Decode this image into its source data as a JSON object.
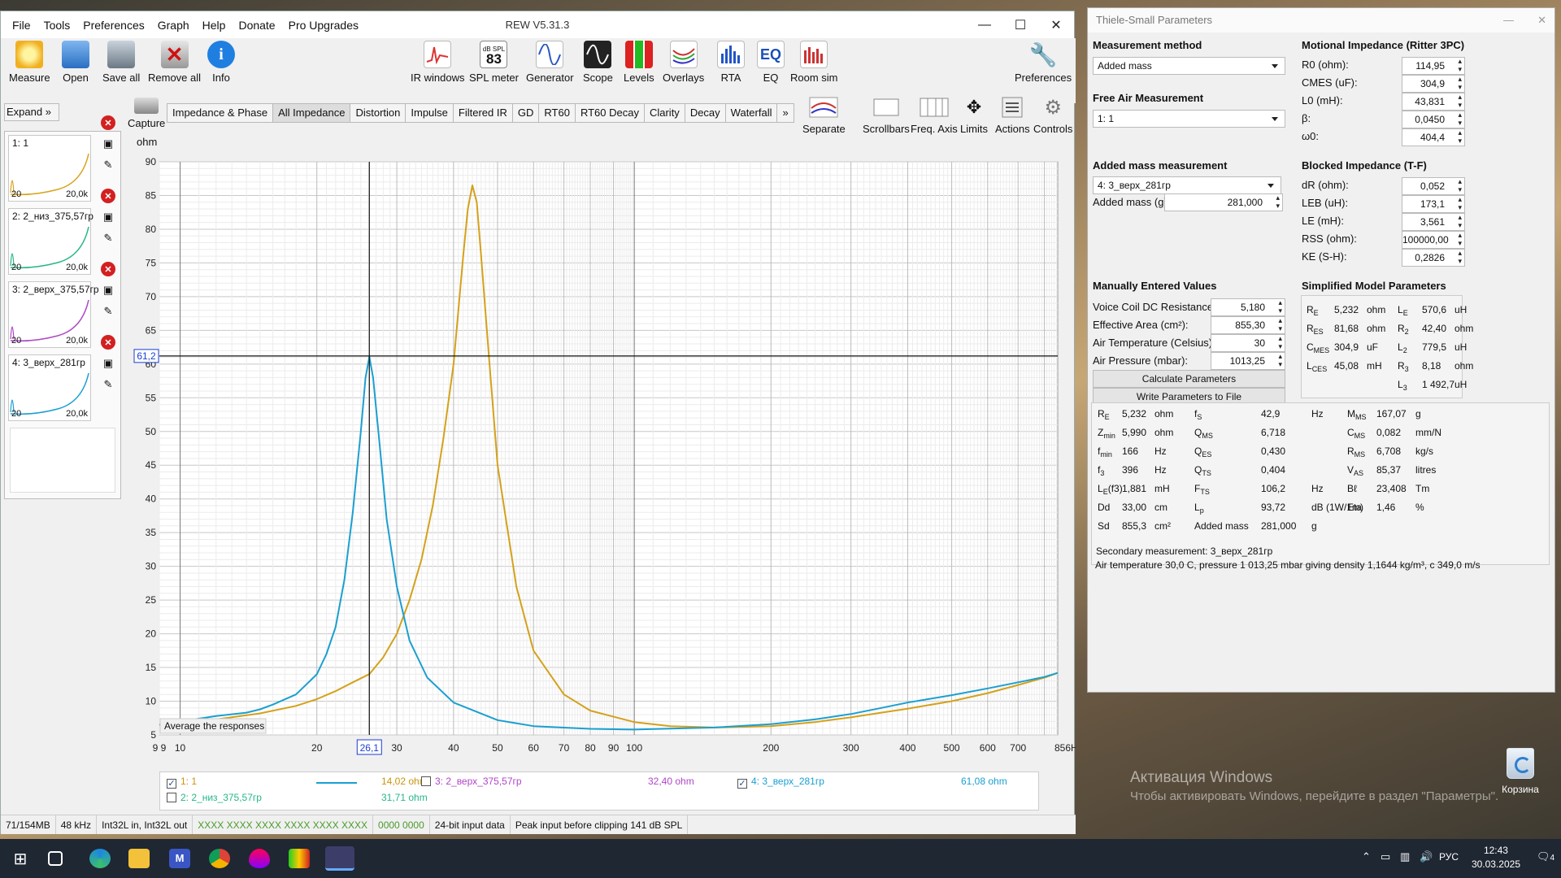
{
  "rew": {
    "title": "REW V5.31.3",
    "menu": [
      "File",
      "Tools",
      "Preferences",
      "Graph",
      "Help",
      "Donate",
      "Pro Upgrades"
    ],
    "toolbar_left": [
      "Measure",
      "Open",
      "Save all",
      "Remove all",
      "Info"
    ],
    "toolbar_right": [
      "IR windows",
      "SPL meter",
      "Generator",
      "Scope",
      "Levels",
      "Overlays",
      "RTA",
      "EQ",
      "Room sim"
    ],
    "spl_meter_badge_top": "dB SPL",
    "spl_meter_badge_value": "83",
    "eq_badge": "EQ",
    "preferences_label": "Preferences",
    "expand_label": "Expand",
    "expand_chevron": "»",
    "capture_label": "Capture",
    "graph_tabs": [
      "Impedance & Phase",
      "All Impedance",
      "Distortion",
      "Impulse",
      "Filtered IR",
      "GD",
      "RT60",
      "RT60 Decay",
      "Clarity",
      "Decay",
      "Waterfall"
    ],
    "active_tab": "All Impedance",
    "tabs_more": "»",
    "graph_buttons": [
      "Separate",
      "Scrollbars",
      "Freq. Axis",
      "Limits",
      "Actions",
      "Controls"
    ],
    "measurements": [
      {
        "name": "1: 1",
        "lo": "20",
        "hi": "20,0k",
        "color": "#d9a31a"
      },
      {
        "name": "2: 2_низ_375,57гр",
        "lo": "20",
        "hi": "20,0k",
        "color": "#27b58a"
      },
      {
        "name": "3: 2_верх_375,57гр",
        "lo": "20",
        "hi": "20,0k",
        "color": "#b045c8"
      },
      {
        "name": "4: 3_верх_281гр",
        "lo": "20",
        "hi": "20,0k",
        "color": "#1a9fd2"
      }
    ],
    "status": [
      "71/154MB",
      "48 kHz",
      "Int32L in, Int32L out",
      "XXXX XXXX  XXXX XXXX  XXXX XXXX",
      "0000 0000",
      "24-bit input data",
      "Peak input before clipping 141 dB SPL"
    ],
    "legend": [
      {
        "checked": true,
        "name": "1: 1",
        "value": "14,02 ohm",
        "color": "#c9950c"
      },
      {
        "checked": false,
        "name": "2: 2_низ_375,57гр",
        "value": "31,71 ohm",
        "color": "#27b58a"
      },
      {
        "checked": false,
        "name": "3: 2_верх_375,57гр",
        "value": "32,40 ohm",
        "color": "#b045c8"
      },
      {
        "checked": true,
        "name": "4: 3_верх_281гр",
        "value": "61,08 ohm",
        "color": "#1a9fd2"
      }
    ],
    "average_button": "Average the responses"
  },
  "chart_data": {
    "type": "line",
    "title": "",
    "xlabel": "",
    "ylabel": "ohm",
    "x_scale": "log",
    "xlim": [
      9,
      856
    ],
    "ylim": [
      5,
      90
    ],
    "yticks": [
      5,
      10,
      15,
      20,
      25,
      30,
      35,
      40,
      45,
      50,
      55,
      60,
      65,
      70,
      75,
      80,
      85,
      90
    ],
    "xtick_labels": [
      {
        "f": 9,
        "label": "9 9"
      },
      {
        "f": 10,
        "label": "10"
      },
      {
        "f": 20,
        "label": "20"
      },
      {
        "f": 30,
        "label": "30"
      },
      {
        "f": 40,
        "label": "40"
      },
      {
        "f": 50,
        "label": "50"
      },
      {
        "f": 60,
        "label": "60"
      },
      {
        "f": 70,
        "label": "70"
      },
      {
        "f": 80,
        "label": "80"
      },
      {
        "f": 90,
        "label": "90"
      },
      {
        "f": 100,
        "label": "100"
      },
      {
        "f": 200,
        "label": "200"
      },
      {
        "f": 300,
        "label": "300"
      },
      {
        "f": 400,
        "label": "400"
      },
      {
        "f": 500,
        "label": "500"
      },
      {
        "f": 600,
        "label": "600"
      },
      {
        "f": 700,
        "label": "700"
      },
      {
        "f": 856,
        "label": "856Hz"
      }
    ],
    "cursor": {
      "x": 26.1,
      "y": 61.2,
      "x_label": "26,1",
      "y_label": "61,2"
    },
    "grid": true,
    "series": [
      {
        "name": "1: 1",
        "color": "#d4a11a",
        "x": [
          9,
          10,
          12,
          15,
          18,
          20,
          22,
          24,
          26.1,
          28,
          30,
          32,
          34,
          36,
          38,
          40,
          41,
          42,
          43,
          44,
          45,
          46,
          48,
          50,
          55,
          60,
          70,
          80,
          100,
          120,
          150,
          200,
          250,
          300,
          350,
          400,
          500,
          600,
          700,
          800,
          856
        ],
        "y": [
          6.5,
          6.8,
          7.3,
          8.2,
          9.3,
          10.3,
          11.5,
          12.8,
          14.02,
          16.5,
          20,
          25,
          31,
          39,
          49,
          60,
          68,
          76,
          83,
          86.5,
          84,
          76,
          60,
          45,
          27,
          17.5,
          11,
          8.6,
          6.9,
          6.3,
          6.1,
          6.3,
          6.9,
          7.6,
          8.3,
          8.9,
          10,
          11.2,
          12.4,
          13.5,
          14.2
        ]
      },
      {
        "name": "4: 3_верх_281гр",
        "color": "#1b9fd0",
        "x": [
          9,
          10,
          12,
          14,
          15,
          16,
          18,
          20,
          21,
          22,
          23,
          24,
          25,
          25.6,
          26.1,
          26.6,
          27.5,
          28.5,
          30,
          32,
          35,
          40,
          50,
          60,
          80,
          100,
          150,
          200,
          250,
          300,
          350,
          400,
          500,
          600,
          700,
          800,
          856
        ],
        "y": [
          6.5,
          7,
          7.8,
          8.3,
          8.8,
          9.5,
          11,
          14,
          17,
          21,
          28,
          38,
          50,
          58,
          61.08,
          58,
          48,
          37,
          27,
          19,
          13.5,
          9.8,
          7.2,
          6.3,
          5.9,
          5.8,
          6.1,
          6.6,
          7.3,
          8.1,
          9,
          9.8,
          10.9,
          11.9,
          12.8,
          13.6,
          14.2
        ]
      }
    ]
  },
  "ts": {
    "title": "Thiele-Small Parameters",
    "measurement_method_h": "Measurement method",
    "measurement_method": "Added mass",
    "free_air_h": "Free Air Measurement",
    "free_air": "1: 1",
    "added_mass_h": "Added mass measurement",
    "added_mass_meas": "4: 3_верх_281гр",
    "added_mass_label": "Added mass (g):",
    "added_mass_value": "281,000",
    "manual_h": "Manually Entered Values",
    "manual": [
      {
        "label": "Voice Coil DC Resistance (ohm):",
        "value": "5,180"
      },
      {
        "label": "Effective Area (cm²):",
        "value": "855,30"
      },
      {
        "label": "Air Temperature (Celsius):",
        "value": "30"
      },
      {
        "label": "Air Pressure (mbar):",
        "value": "1013,25"
      }
    ],
    "calc_button": "Calculate Parameters",
    "write_button": "Write Parameters to File",
    "motional_h": "Motional Impedance (Ritter 3PC)",
    "motional": [
      {
        "label": "R0 (ohm):",
        "value": "114,95"
      },
      {
        "label": "CMES (uF):",
        "value": "304,9"
      },
      {
        "label": "L0 (mH):",
        "value": "43,831"
      },
      {
        "label": "β:",
        "value": "0,0450"
      },
      {
        "label": "ω0:",
        "value": "404,4"
      }
    ],
    "blocked_h": "Blocked Impedance (T-F)",
    "blocked": [
      {
        "label": "dR (ohm):",
        "value": "0,052"
      },
      {
        "label": "LEB (uH):",
        "value": "173,1"
      },
      {
        "label": "LE (mH):",
        "value": "3,561"
      },
      {
        "label": "RSS (ohm):",
        "value": "100000,00"
      },
      {
        "label": "KE (S-H):",
        "value": "0,2826"
      }
    ],
    "simplified_h": "Simplified Model Parameters",
    "simplified_left": [
      {
        "sym": "R",
        "sub": "E",
        "value": "5,232",
        "unit": "ohm"
      },
      {
        "sym": "R",
        "sub": "ES",
        "value": "81,68",
        "unit": "ohm"
      },
      {
        "sym": "C",
        "sub": "MES",
        "value": "304,9",
        "unit": "uF"
      },
      {
        "sym": "L",
        "sub": "CES",
        "value": "45,08",
        "unit": "mH"
      }
    ],
    "simplified_right": [
      {
        "sym": "L",
        "sub": "E",
        "value": "570,6",
        "unit": "uH"
      },
      {
        "sym": "R",
        "sub": "2",
        "value": "42,40",
        "unit": "ohm"
      },
      {
        "sym": "L",
        "sub": "2",
        "value": "779,5",
        "unit": "uH"
      },
      {
        "sym": "R",
        "sub": "3",
        "value": "8,18",
        "unit": "ohm"
      },
      {
        "sym": "L",
        "sub": "3",
        "value": "1 492,7",
        "unit": "uH"
      }
    ],
    "results_c1": [
      {
        "sym": "R",
        "sub": "E",
        "value": "5,232",
        "unit": "ohm"
      },
      {
        "sym": "Z",
        "sub": "min",
        "value": "5,990",
        "unit": "ohm"
      },
      {
        "sym": "f",
        "sub": "min",
        "value": "166",
        "unit": "Hz"
      },
      {
        "sym": "f",
        "sub": "3",
        "value": "396",
        "unit": "Hz"
      },
      {
        "sym": "L",
        "sub": "E",
        "value": "1,881",
        "unit": "mH"
      },
      {
        "sym": "Dd",
        "sub": "",
        "value": "33,00",
        "unit": "cm"
      },
      {
        "sym": "Sd",
        "sub": "",
        "value": "855,3",
        "unit": "cm²"
      }
    ],
    "results_c2": [
      {
        "sym": "f",
        "sub": "S",
        "value": "42,9",
        "unit": "Hz"
      },
      {
        "sym": "Q",
        "sub": "MS",
        "value": "6,718",
        "unit": ""
      },
      {
        "sym": "Q",
        "sub": "ES",
        "value": "0,430",
        "unit": ""
      },
      {
        "sym": "Q",
        "sub": "TS",
        "value": "0,404",
        "unit": ""
      },
      {
        "sym": "F",
        "sub": "TS",
        "value": "106,2",
        "unit": "Hz"
      },
      {
        "sym": "L",
        "sub": "p",
        "value": "93,72",
        "unit": "dB (1W/1m)"
      },
      {
        "sym": "Added mass",
        "sub": "",
        "value": "281,000",
        "unit": "g"
      }
    ],
    "results_c3": [
      {
        "sym": "M",
        "sub": "MS",
        "value": "167,07",
        "unit": "g"
      },
      {
        "sym": "C",
        "sub": "MS",
        "value": "0,082",
        "unit": "mm/N"
      },
      {
        "sym": "R",
        "sub": "MS",
        "value": "6,708",
        "unit": "kg/s"
      },
      {
        "sym": "V",
        "sub": "AS",
        "value": "85,37",
        "unit": "litres"
      },
      {
        "sym": "Bℓ",
        "sub": "",
        "value": "23,408",
        "unit": "Tm"
      },
      {
        "sym": "Eta",
        "sub": "",
        "value": "1,46",
        "unit": "%"
      }
    ],
    "le_f3_suffix": "(f3)",
    "secondary": "Secondary measurement: 3_верх_281гр",
    "air_info": "Air temperature 30,0 C, pressure 1 013,25 mbar giving density 1,1644 kg/m³, c 349,0 m/s"
  },
  "desktop": {
    "watermark_title": "Активация Windows",
    "watermark_sub": "Чтобы активировать Windows, перейдите в раздел \"Параметры\".",
    "recycle_bin": "Корзина",
    "lang": "РУС",
    "time": "12:43",
    "date": "30.03.2025",
    "notification_count": "4"
  }
}
